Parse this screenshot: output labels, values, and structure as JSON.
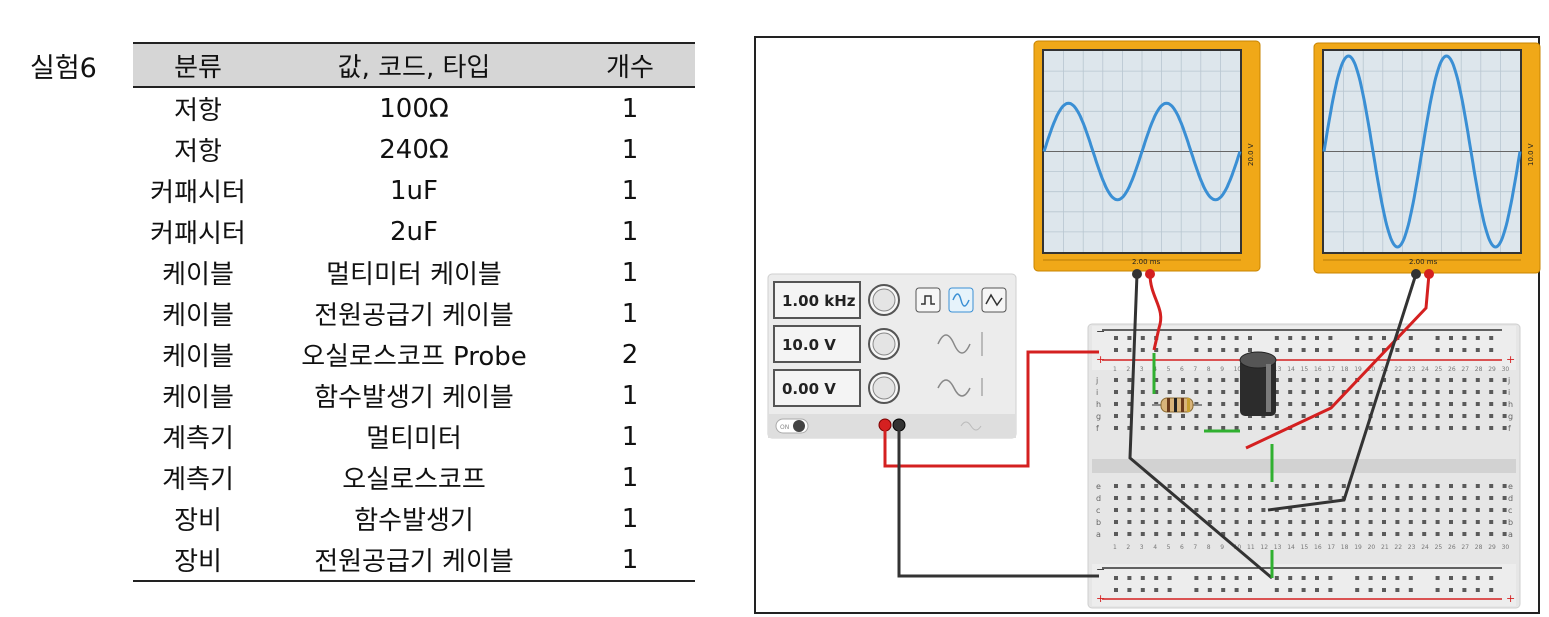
{
  "experiment_label": "실험6",
  "table": {
    "headers": [
      "분류",
      "값, 코드, 타입",
      "개수"
    ],
    "rows": [
      [
        "저항",
        "100Ω",
        "1"
      ],
      [
        "저항",
        "240Ω",
        "1"
      ],
      [
        "커패시터",
        "1uF",
        "1"
      ],
      [
        "커패시터",
        "2uF",
        "1"
      ],
      [
        "케이블",
        "멀티미터 케이블",
        "1"
      ],
      [
        "케이블",
        "전원공급기 케이블",
        "1"
      ],
      [
        "케이블",
        "오실로스코프 Probe",
        "2"
      ],
      [
        "케이블",
        "함수발생기 케이블",
        "1"
      ],
      [
        "계측기",
        "멀티미터",
        "1"
      ],
      [
        "계측기",
        "오실로스코프",
        "1"
      ],
      [
        "장비",
        "함수발생기",
        "1"
      ],
      [
        "장비",
        "전원공급기 케이블",
        "1"
      ]
    ]
  },
  "function_generator": {
    "frequency": "1.00 kHz",
    "amplitude": "10.0 V",
    "offset": "0.00 V",
    "power_label": "ON",
    "waveforms": [
      "square",
      "sine",
      "triangle"
    ],
    "selected_waveform": "sine"
  },
  "oscilloscope_1": {
    "time_per_div": "2.00 ms",
    "volts_per_div": "20.0 V",
    "relative_amplitude": 0.48,
    "cycles": 2
  },
  "oscilloscope_2": {
    "time_per_div": "2.00 ms",
    "volts_per_div": "10.0 V",
    "relative_amplitude": 0.95,
    "cycles": 2
  },
  "breadboard": {
    "row_letters_top": [
      "j",
      "i",
      "h",
      "g",
      "f"
    ],
    "row_letters_bottom": [
      "e",
      "d",
      "c",
      "b",
      "a"
    ],
    "column_count": 30,
    "rail_minus": "−",
    "rail_plus": "+"
  },
  "colors": {
    "scope_frame": "#f0a818",
    "screen_bg": "#dde6ec",
    "trace": "#3a8fd4",
    "wire_red": "#d42020",
    "wire_black": "#333333",
    "wire_green": "#30b030",
    "rail_red": "#d42020"
  }
}
